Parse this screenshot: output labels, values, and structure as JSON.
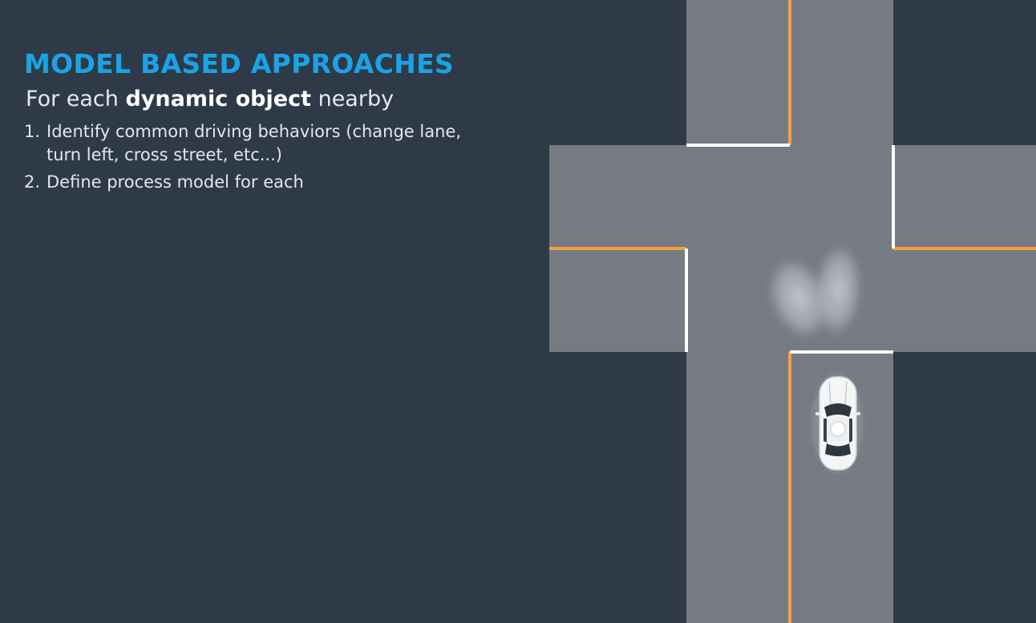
{
  "slide": {
    "title": "MODEL BASED APPROACHES",
    "subtitle_prefix": "For each ",
    "subtitle_bold": "dynamic object",
    "subtitle_suffix": " nearby",
    "steps": [
      {
        "number": "1.",
        "text": "Identify common driving behaviors (change lane, turn left, cross street, etc...)"
      },
      {
        "number": "2.",
        "text": "Define process model for each"
      }
    ]
  },
  "colors": {
    "background": "#2e3a48",
    "title": "#1aa3e6",
    "road": "#767b83",
    "lane_divider": "#f3a03a",
    "stop_line": "#ffffff"
  },
  "icons": {
    "vehicle": "car-top-view-icon",
    "prediction": "prediction-blob-icon"
  }
}
